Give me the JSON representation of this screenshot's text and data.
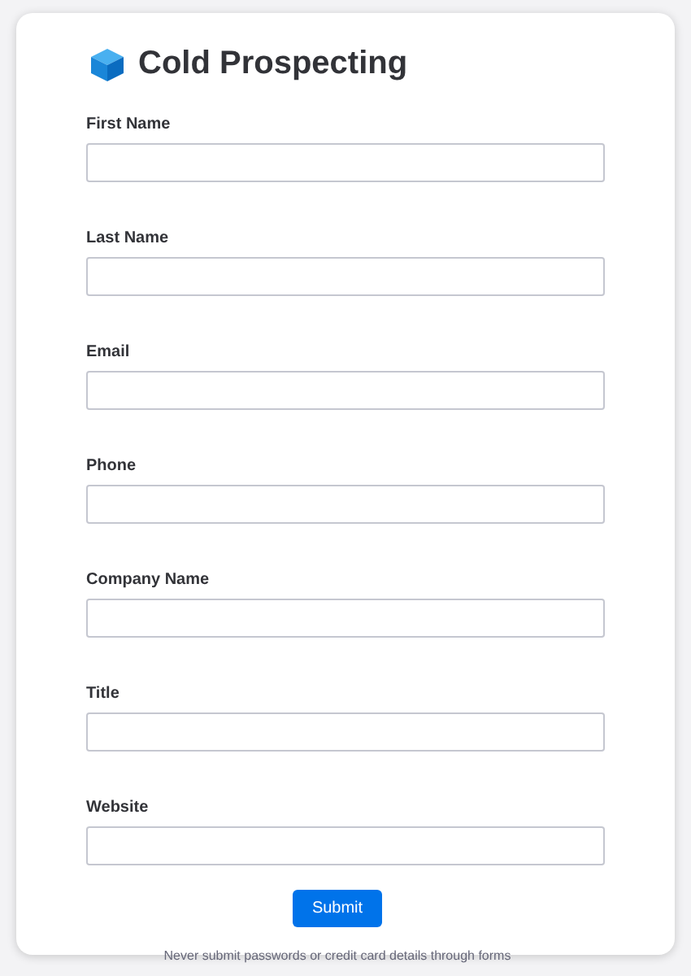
{
  "form": {
    "title": "Cold Prospecting",
    "fields": [
      {
        "label": "First Name"
      },
      {
        "label": "Last Name"
      },
      {
        "label": "Email"
      },
      {
        "label": "Phone"
      },
      {
        "label": "Company Name"
      },
      {
        "label": "Title"
      },
      {
        "label": "Website"
      }
    ],
    "submit": "Submit",
    "notice": "Never submit passwords or credit card details through forms"
  }
}
